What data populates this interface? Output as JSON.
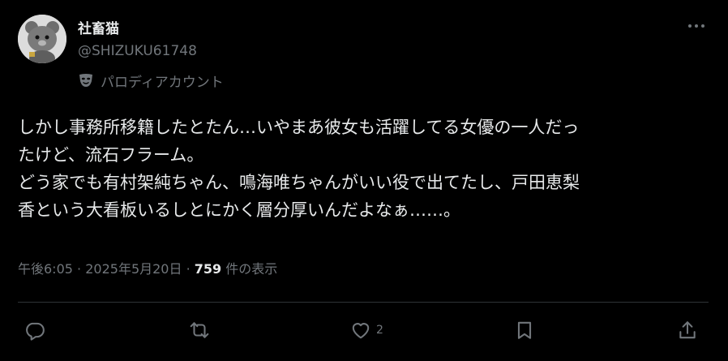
{
  "post": {
    "display_name": "社畜猫",
    "handle": "@SHIZUKU61748",
    "parody_label": "パロディアカウント",
    "text_lines": [
      "しかし事務所移籍したとたん…いやまあ彼女も活躍してる女優の一人だっ",
      "たけど、流石フラーム。",
      "どう家でも有村架純ちゃん、鳴海唯ちゃんがいい役で出てたし、戸田恵梨",
      "香という大看板いるしとにかく層分厚いんだよなぁ……。"
    ],
    "time": "午後6:05",
    "separator": "·",
    "date": "2025年5月20日",
    "views_count": "759",
    "views_label": "件の表示"
  },
  "actions": {
    "like_count": "2"
  },
  "icons": {
    "more": "more-horizontal-icon",
    "mask": "theater-mask-icon",
    "reply": "reply-icon",
    "repost": "repost-icon",
    "like": "heart-icon",
    "bookmark": "bookmark-icon",
    "share": "share-icon"
  },
  "colors": {
    "background": "#000000",
    "text_primary": "#e7e9ea",
    "text_secondary": "#71767b",
    "divider": "#2f3336"
  }
}
